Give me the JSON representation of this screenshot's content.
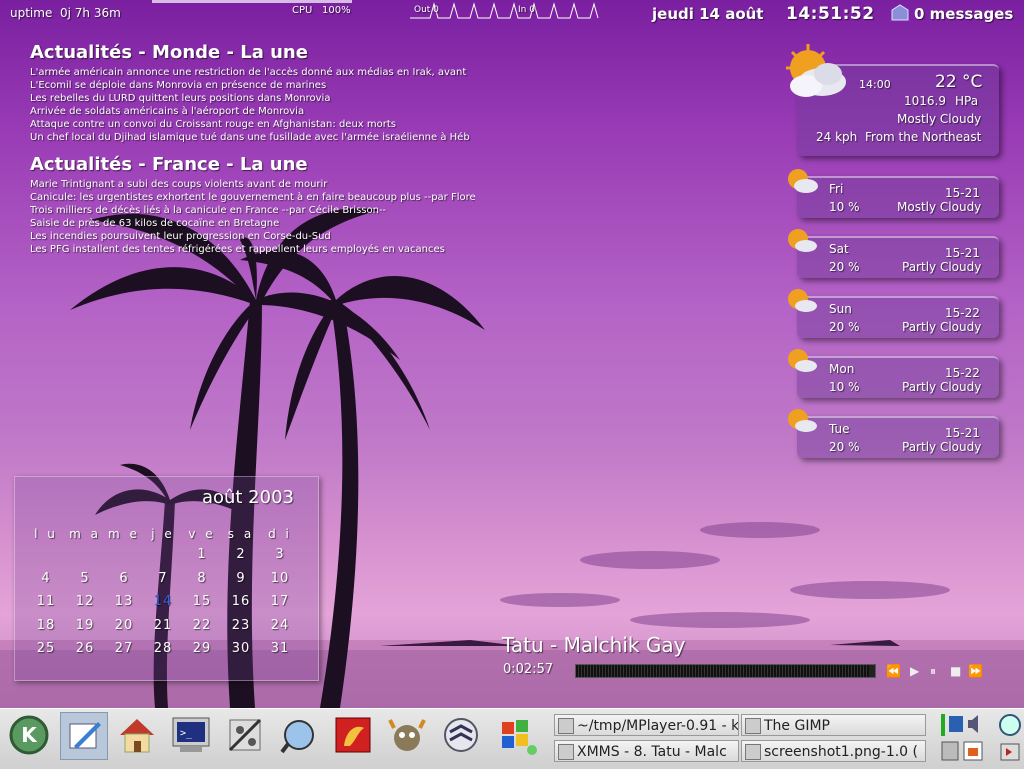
{
  "top_bar": {
    "uptime_label": "uptime",
    "uptime_value": "0j 7h 36m",
    "cpu_label": "CPU",
    "cpu_value": "100%",
    "net_out_label": "Out 0",
    "net_in_label": "In 0",
    "date": "jeudi 14 août",
    "time": "14:51:52",
    "messages": "0 messages"
  },
  "news": [
    {
      "title": "Actualités - Monde - La une",
      "items": [
        "L'armée américain annonce une restriction de l'accès donné aux médias en Irak, avant",
        "L'Ecomil se déploie dans Monrovia en présence de marines",
        "Les rebelles du LURD quittent leurs positions dans Monrovia",
        "Arrivée de soldats américains à l'aéroport de Monrovia",
        "Attaque contre un convoi du Croissant rouge en Afghanistan: deux morts",
        "Un chef local du Djihad islamique tué dans une fusillade avec l'armée israélienne à Héb"
      ]
    },
    {
      "title": "Actualités - France - La une",
      "items": [
        "Marie Trintignant a subi des coups violents avant de mourir",
        "Canicule: les urgentistes exhortent le gouvernement à en faire beaucoup plus --par Florer",
        "Trois milliers de décès liés à la canicule en France --par Cécile Brisson--",
        "Saisie de près de 63 kilos de cocaïne en Bretagne",
        "Les incendies poursuivent leur progression en Corse-du-Sud",
        "Les PFG installent des tentes réfrigérées et rappellent leurs employés en vacances"
      ]
    }
  ],
  "weather": {
    "current": {
      "time": "14:00",
      "temp": "22 °C",
      "pressure": "1016.9",
      "pressure_unit": "HPa",
      "condition": "Mostly Cloudy",
      "wind": "24 kph",
      "wind_dir": "From the Northeast"
    },
    "forecast": [
      {
        "day": "Fri",
        "range": "15-21",
        "precip": "10 %",
        "condition": "Mostly Cloudy"
      },
      {
        "day": "Sat",
        "range": "15-21",
        "precip": "20 %",
        "condition": "Partly Cloudy"
      },
      {
        "day": "Sun",
        "range": "15-22",
        "precip": "20 %",
        "condition": "Partly Cloudy"
      },
      {
        "day": "Mon",
        "range": "15-22",
        "precip": "10 %",
        "condition": "Partly Cloudy"
      },
      {
        "day": "Tue",
        "range": "15-21",
        "precip": "20 %",
        "condition": "Partly Cloudy"
      }
    ]
  },
  "calendar": {
    "title": "août 2003",
    "weekdays": [
      "lu",
      "ma",
      "me",
      "je",
      "ve",
      "sa",
      "di"
    ],
    "weeks": [
      [
        "",
        "",
        "",
        "",
        "1",
        "2",
        "3"
      ],
      [
        "4",
        "5",
        "6",
        "7",
        "8",
        "9",
        "10"
      ],
      [
        "11",
        "12",
        "13",
        "14",
        "15",
        "16",
        "17"
      ],
      [
        "18",
        "19",
        "20",
        "21",
        "22",
        "23",
        "24"
      ],
      [
        "25",
        "26",
        "27",
        "28",
        "29",
        "30",
        "31"
      ]
    ],
    "today": "14"
  },
  "player": {
    "song": "Tatu - Malchik Gay",
    "elapsed": "0:02:57",
    "progress": 0.98,
    "controls": [
      "previous-icon",
      "play-icon",
      "pause-icon",
      "stop-icon",
      "next-icon"
    ]
  },
  "taskbar": {
    "launchers": [
      "kde-menu-icon",
      "kate-editor-icon",
      "home-folder-icon",
      "terminal-icon",
      "control-center-icon",
      "konqueror-icon",
      "mozilla-icon",
      "gimp-icon",
      "xmms-icon",
      "windows-icon"
    ],
    "tasks": [
      {
        "label": "~/tmp/MPlayer-0.91 - k"
      },
      {
        "label": "The GIMP"
      },
      {
        "label": "XMMS - 8. Tatu - Malc"
      },
      {
        "label": "screenshot1.png-1.0 ("
      }
    ]
  },
  "colors": {
    "today": "#3060e0",
    "taskbar_bg": "#d8d8d8"
  }
}
